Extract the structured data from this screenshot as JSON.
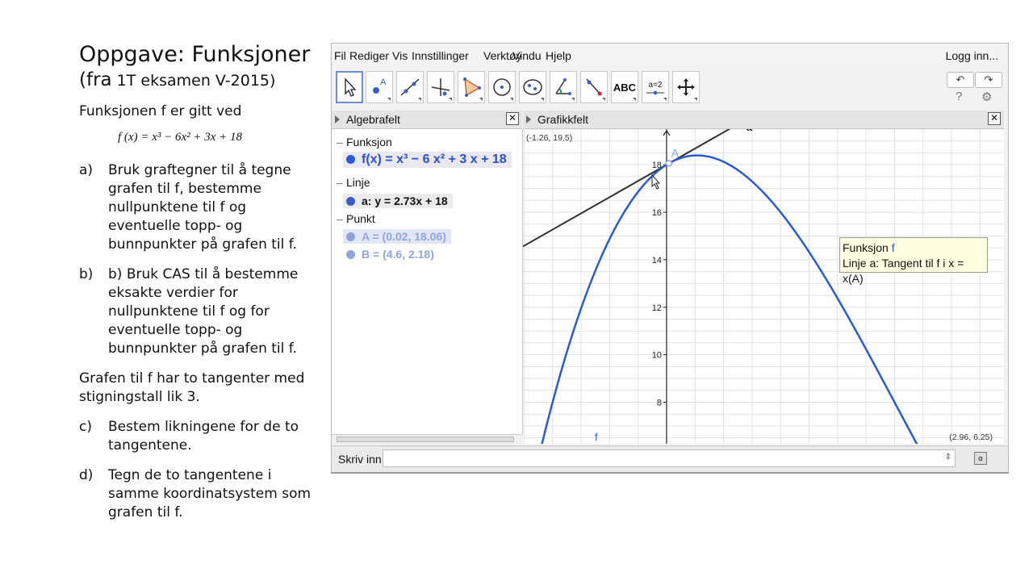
{
  "slide": {
    "title": "Oppgave: Funksjoner",
    "subtitle_prefix": "(fra",
    "subtitle_small": " 1T eksamen V-2015)",
    "intro": "Funksjonen f er gitt ved",
    "formula": "f (x) = x³ − 6x² + 3x + 18",
    "question_a_label": "a)",
    "question_a": "Bruk graftegner til å tegne grafen til f, bestemme nullpunktene til f og eventuelle topp- og bunnpunkter på grafen til f.",
    "question_b_label": "b)",
    "question_b": "b) Bruk CAS til å bestemme eksakte verdier for nullpunktene til f og for eventuelle topp- og bunnpunkter på grafen til f.",
    "paragraph": "Grafen til f har to tangenter med stigningstall lik 3.",
    "question_c_label": "c)",
    "question_c": "Bestem likningene for de to tangentene.",
    "question_d_label": "d)",
    "question_d": "Tegn de to tangentene i samme koordinatsystem som grafen til f."
  },
  "geogebra": {
    "menu": [
      "Fil",
      "Rediger",
      "Vis",
      "Innstillinger",
      "Verktøy",
      "Vindu",
      "Hjelp"
    ],
    "login": "Logg inn...",
    "undo_symbol": "↶",
    "redo_symbol": "↷",
    "help_symbol": "?",
    "settings_symbol": "⚙",
    "tools": [
      {
        "name": "move-tool-icon"
      },
      {
        "name": "point-tool-icon"
      },
      {
        "name": "line-tool-icon"
      },
      {
        "name": "perpendicular-tool-icon"
      },
      {
        "name": "polygon-tool-icon"
      },
      {
        "name": "circle-tool-icon"
      },
      {
        "name": "ellipse-tool-icon"
      },
      {
        "name": "angle-tool-icon"
      },
      {
        "name": "reflect-tool-icon"
      },
      {
        "name": "text-tool-icon",
        "label": "ABC"
      },
      {
        "name": "slider-tool-icon",
        "label": "a=2"
      },
      {
        "name": "move-graphics-tool-icon"
      }
    ],
    "algebra_header": "Algebrafelt",
    "graphics_header": "Grafikkfelt",
    "close_symbol": "✕",
    "algebra": {
      "cat_funksjon": "Funksjon",
      "f": "f(x) = x³ − 6 x² + 3 x + 18",
      "cat_linje": "Linje",
      "a": "a: y = 2.73x + 18",
      "cat_punkt": "Punkt",
      "A": "A = (0.02, 18.06)",
      "B": "B = (4.6, 2.18)"
    },
    "graph": {
      "corner_top_left": "(-1.26, 19.5)",
      "corner_bottom_right": "(2.96, 6.25)",
      "line_label": "a",
      "point_label": "A",
      "curve_label": "f",
      "y_ticks": [
        "18",
        "16",
        "14",
        "12",
        "10",
        "8"
      ],
      "colors": {
        "curve": "#2a5bd7",
        "tangent": "#333333",
        "grid": "#e2e2e2",
        "axis": "#222222",
        "point": "#8ea2dc"
      }
    },
    "tooltip": {
      "line1_prefix": "Funksjon ",
      "line1_name": "f",
      "line2": "Linje a: Tangent til f i x = x(A)"
    },
    "input_label": "Skriv inn:",
    "spin_symbol": "⇕",
    "keyboard_symbol": "α"
  }
}
